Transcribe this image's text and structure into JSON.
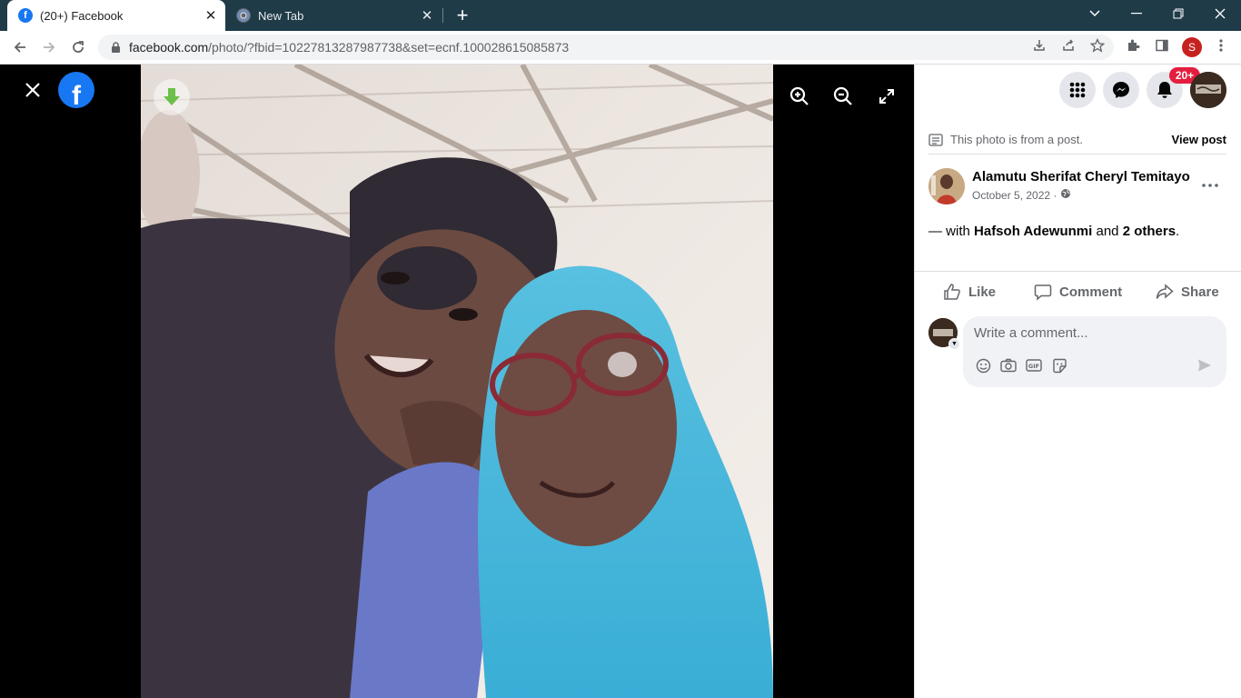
{
  "browser": {
    "tabs": [
      {
        "title": "(20+) Facebook",
        "favicon": "facebook-icon"
      },
      {
        "title": "New Tab",
        "favicon": "chrome-icon"
      }
    ],
    "url_host": "facebook.com",
    "url_path": "/photo/?fbid=10227813287987738&set=ecnf.100028615085873",
    "profile_initial": "S"
  },
  "viewer": {
    "close_icon": "close-icon",
    "logo": "f",
    "controls": [
      "zoom-in-icon",
      "zoom-out-icon",
      "fullscreen-icon"
    ],
    "download_icon": "download-arrow-icon"
  },
  "panel": {
    "notification_badge": "20+",
    "from_post_text": "This photo is from a post.",
    "view_post_label": "View post",
    "author_name": "Alamutu Sherifat Cheryl Temitayo",
    "post_date": "October 5, 2022 ·",
    "with_prefix": "— with ",
    "with_person": "Hafsoh Adewunmi",
    "with_and": " and ",
    "with_others": "2 others",
    "with_end": ".",
    "actions": {
      "like": "Like",
      "comment": "Comment",
      "share": "Share"
    },
    "comment_placeholder": "Write a comment..."
  },
  "colors": {
    "facebook_blue": "#1877f2",
    "badge_red": "#e41e3f",
    "tabbar": "#1f3b48"
  }
}
